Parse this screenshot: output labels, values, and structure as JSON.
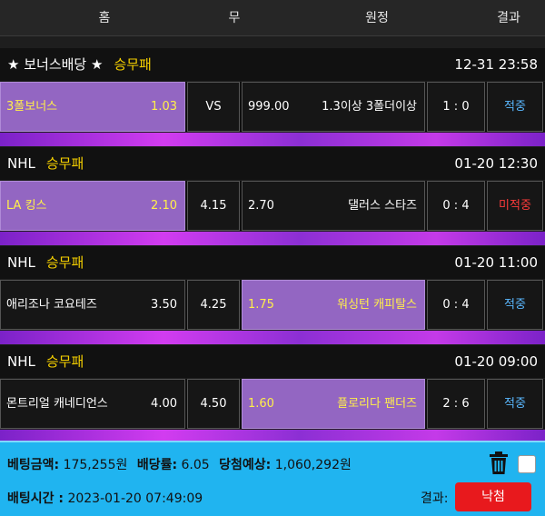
{
  "header": {
    "home": "홈",
    "draw": "무",
    "away": "원정",
    "result": "결과"
  },
  "games": [
    {
      "league": "★ 보너스배당 ★",
      "type": "승무패",
      "time": "12-31 23:58",
      "home_team": "3폴보너스",
      "home_odds": "1.03",
      "draw": "VS",
      "away_odds": "999.00",
      "away_team": "1.3이상 3폴더이상",
      "score": "1 : 0",
      "result": "적중",
      "selected": "home"
    },
    {
      "league": "NHL",
      "type": "승무패",
      "time": "01-20 12:30",
      "home_team": "LA 킹스",
      "home_odds": "2.10",
      "draw": "4.15",
      "away_odds": "2.70",
      "away_team": "댈러스 스타즈",
      "score": "0 : 4",
      "result": "미적중",
      "selected": "home"
    },
    {
      "league": "NHL",
      "type": "승무패",
      "time": "01-20 11:00",
      "home_team": "애리조나 코요테즈",
      "home_odds": "3.50",
      "draw": "4.25",
      "away_odds": "1.75",
      "away_team": "워싱턴 캐피탈스",
      "score": "0 : 4",
      "result": "적중",
      "selected": "away"
    },
    {
      "league": "NHL",
      "type": "승무패",
      "time": "01-20 09:00",
      "home_team": "몬트리얼 캐네디언스",
      "home_odds": "4.00",
      "draw": "4.50",
      "away_odds": "1.60",
      "away_team": "플로리다 팬더즈",
      "score": "2 : 6",
      "result": "적중",
      "selected": "away"
    }
  ],
  "summary": {
    "bet_amount_label": "베팅금액:",
    "bet_amount": "175,255원",
    "odds_label": "배당률:",
    "odds": "6.05",
    "expected_label": "당첨예상:",
    "expected": "1,060,292원",
    "bet_time_label": "배팅시간 :",
    "bet_time": "2023-01-20 07:49:09",
    "result_label": "결과:",
    "result_button": "낙첨"
  },
  "colors": {
    "selected": "#9366c2",
    "hit": "#5ab8ff",
    "miss": "#ff3b3b",
    "summary_bg": "#20b4f0",
    "lose": "#e8191d"
  }
}
